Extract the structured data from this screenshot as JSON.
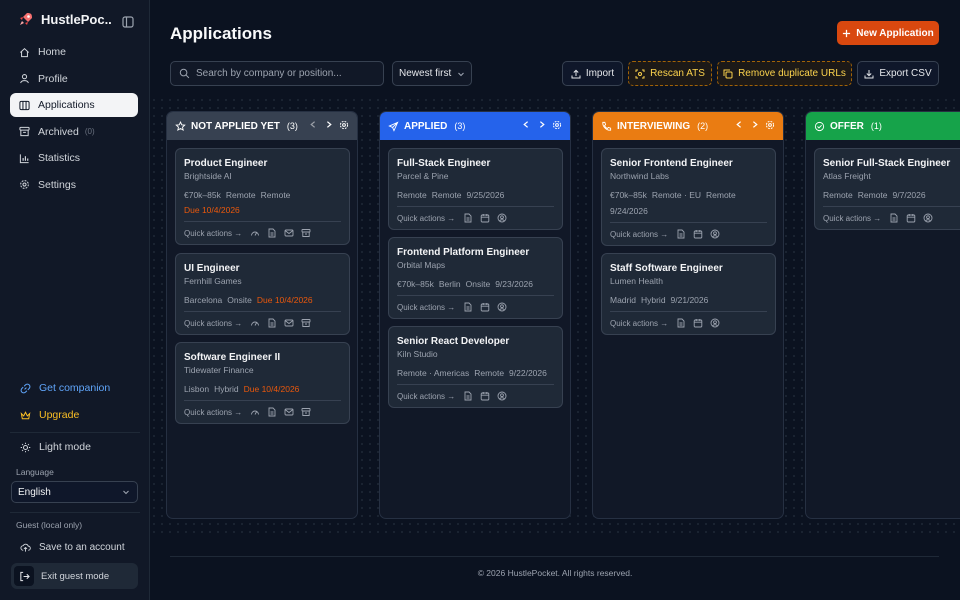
{
  "sidebar": {
    "brand": "HustlePoc...",
    "nav": [
      {
        "label": "Home",
        "icon": "home-icon"
      },
      {
        "label": "Profile",
        "icon": "user-icon"
      },
      {
        "label": "Applications",
        "icon": "columns-icon",
        "active": true
      },
      {
        "label": "Archived",
        "icon": "archive-icon",
        "count": "(0)"
      },
      {
        "label": "Statistics",
        "icon": "bar-chart-icon"
      },
      {
        "label": "Settings",
        "icon": "gear-icon"
      }
    ],
    "companion": "Get companion",
    "upgrade": "Upgrade",
    "light_mode": "Light mode",
    "language_label": "Language",
    "language_value": "English",
    "guest_label": "Guest (local only)",
    "save_account": "Save to an account",
    "exit_guest": "Exit guest mode"
  },
  "header": {
    "title": "Applications",
    "new_button": "New Application",
    "search_placeholder": "Search by company or position...",
    "sort_value": "Newest first",
    "import": "Import",
    "rescan": "Rescan ATS",
    "remove_dupes": "Remove duplicate URLs",
    "export": "Export CSV"
  },
  "board": {
    "quick_actions": "Quick actions →",
    "columns": [
      {
        "title": "NOT APPLIED YET",
        "count": "(3)",
        "color": "#374151",
        "cards": [
          {
            "title": "Product Engineer",
            "company": "Brightside AI",
            "meta": [
              "€70k–85k",
              "Remote",
              "Remote"
            ],
            "due": "Due 10/4/2026",
            "due_inline": false
          },
          {
            "title": "UI Engineer",
            "company": "Fernhill Games",
            "meta": [
              "Barcelona",
              "Onsite"
            ],
            "due": "Due 10/4/2026",
            "due_inline": true
          },
          {
            "title": "Software Engineer II",
            "company": "Tidewater Finance",
            "meta": [
              "Lisbon",
              "Hybrid"
            ],
            "due": "Due 10/4/2026",
            "due_inline": true
          }
        ]
      },
      {
        "title": "APPLIED",
        "count": "(3)",
        "color": "#2563eb",
        "cards": [
          {
            "title": "Full-Stack Engineer",
            "company": "Parcel & Pine",
            "meta": [
              "Remote",
              "Remote",
              "9/25/2026"
            ]
          },
          {
            "title": "Frontend Platform Engineer",
            "company": "Orbital Maps",
            "meta": [
              "€70k–85k",
              "Berlin",
              "Onsite",
              "9/23/2026"
            ]
          },
          {
            "title": "Senior React Developer",
            "company": "Kiln Studio",
            "meta": [
              "Remote · Americas",
              "Remote",
              "9/22/2026"
            ]
          }
        ]
      },
      {
        "title": "INTERVIEWING",
        "count": "(2)",
        "color": "#ea7c12",
        "cards": [
          {
            "title": "Senior Frontend Engineer",
            "company": "Northwind Labs",
            "meta": [
              "€70k–85k",
              "Remote · EU",
              "Remote",
              "9/24/2026"
            ]
          },
          {
            "title": "Staff Software Engineer",
            "company": "Lumen Health",
            "meta": [
              "Madrid",
              "Hybrid",
              "9/21/2026"
            ]
          }
        ]
      },
      {
        "title": "OFFER",
        "count": "(1)",
        "color": "#16a34a",
        "cards": [
          {
            "title": "Senior Full-Stack Engineer",
            "company": "Atlas Freight",
            "meta": [
              "Remote",
              "Remote",
              "9/7/2026"
            ]
          }
        ]
      }
    ]
  },
  "footer": "© 2026 HustlePocket. All rights reserved."
}
